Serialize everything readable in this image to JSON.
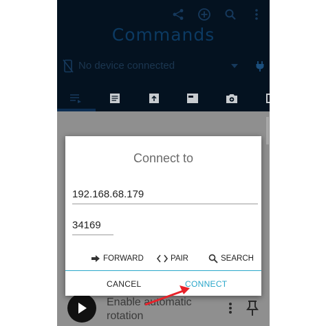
{
  "app": {
    "title": "Commands",
    "device_status": "No device connected",
    "toolbar_icons": [
      "share-icon",
      "add-circle-icon",
      "search-icon",
      "more-vert-icon"
    ],
    "tabs": [
      "list-icon",
      "document-icon",
      "upload-box-icon",
      "browser-icon",
      "camera-add-icon",
      "partial-icon"
    ]
  },
  "background_item": {
    "title": "Enable automatic rotation"
  },
  "dialog": {
    "title": "Connect to",
    "ip_value": "192.168.68.179",
    "port_value": "34169",
    "options": {
      "forward": "FORWARD",
      "pair": "PAIR",
      "search": "SEARCH"
    },
    "cancel": "CANCEL",
    "connect": "CONNECT"
  },
  "colors": {
    "appbar": "#041220",
    "accent": "#29a6c9",
    "annotation_arrow": "#e8222a"
  }
}
